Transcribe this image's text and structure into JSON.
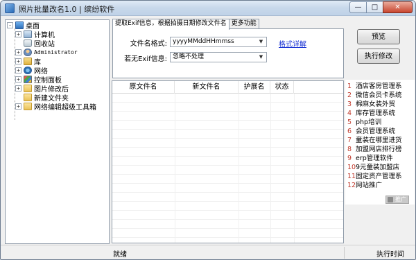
{
  "window": {
    "title": "照片批量改名1.0 | 缤纷软件",
    "min_icon": "minimize-icon",
    "max_icon": "maximize-icon",
    "close_icon": "close-icon"
  },
  "tree": {
    "items": [
      {
        "label": "桌面",
        "icon": "desktop-icon"
      },
      {
        "label": "计算机",
        "icon": "computer-icon"
      },
      {
        "label": "回收站",
        "icon": "recycle-bin-icon"
      },
      {
        "label": "Administrator",
        "icon": "user-folder-icon"
      },
      {
        "label": "库",
        "icon": "library-icon"
      },
      {
        "label": "网络",
        "icon": "network-icon"
      },
      {
        "label": "控制面板",
        "icon": "control-panel-icon"
      },
      {
        "label": "图片修改后",
        "icon": "folder-icon"
      },
      {
        "label": "新建文件夹",
        "icon": "folder-icon"
      },
      {
        "label": "网络编辑超级工具箱",
        "icon": "folder-icon"
      }
    ]
  },
  "tabs": {
    "active": "提取Exif信息，根据拍摄日期修改文件名",
    "more": "更多功能"
  },
  "settings": {
    "format_label": "文件名格式:",
    "format_value": "yyyyMMddHHmmss",
    "noexif_label": "若无Exif信息:",
    "noexif_value": "忽略不处理",
    "format_link": "格式详解"
  },
  "buttons": {
    "preview": "预览",
    "execute": "执行修改"
  },
  "table": {
    "columns": [
      "原文件名",
      "新文件名",
      "护展名",
      "状态"
    ]
  },
  "promo": {
    "items": [
      {
        "num": "1",
        "label": "酒店客房管理系"
      },
      {
        "num": "2",
        "label": "微信会员卡系统"
      },
      {
        "num": "3",
        "label": "棉麻女装外贸"
      },
      {
        "num": "4",
        "label": "库存管理系统"
      },
      {
        "num": "5",
        "label": "php培训"
      },
      {
        "num": "6",
        "label": "会员管理系统"
      },
      {
        "num": "7",
        "label": "童装在哪里进货"
      },
      {
        "num": "8",
        "label": "加盟网店排行榜"
      },
      {
        "num": "9",
        "label": "erp管理软件"
      },
      {
        "num": "10",
        "label": "9元童装加盟店"
      },
      {
        "num": "11",
        "label": "固定资产管理系"
      },
      {
        "num": "12",
        "label": "网站推广"
      }
    ],
    "badge": "推广",
    "num_color": "#c0392b"
  },
  "status": {
    "left": "就绪",
    "right": "执行时间"
  }
}
